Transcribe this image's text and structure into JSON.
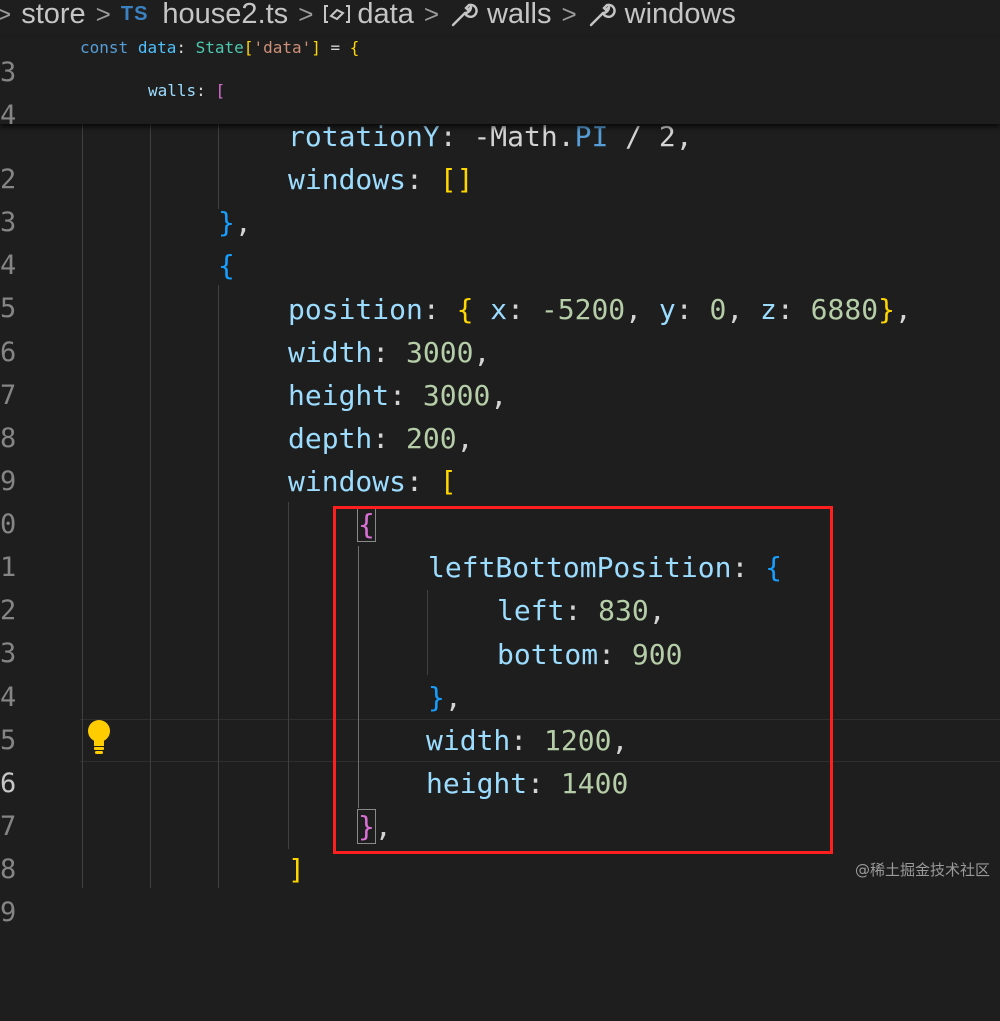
{
  "breadcrumb": {
    "items": [
      {
        "label": "store"
      },
      {
        "badge": "TS",
        "label": "house2.ts"
      },
      {
        "label": "data"
      },
      {
        "label": "walls"
      },
      {
        "label": "windows"
      }
    ]
  },
  "sticky_lines": [
    {
      "num": "3",
      "text": "const data: State['data'] = {"
    },
    {
      "num": "4",
      "text": "walls: ["
    }
  ],
  "lines": [
    {
      "num": "2",
      "text": "rotationY: -Math.PI / 2,"
    },
    {
      "num": "3",
      "text": "windows: []"
    },
    {
      "num": "4",
      "text": "},"
    },
    {
      "num": "5",
      "text": "{"
    },
    {
      "num": "6",
      "text": "position: { x: -5200, y: 0, z: 6880},"
    },
    {
      "num": "7",
      "text": "width: 3000,"
    },
    {
      "num": "8",
      "text": "height: 3000,"
    },
    {
      "num": "9",
      "text": "depth: 200,"
    },
    {
      "num": "0",
      "text": "windows: ["
    },
    {
      "num": "1",
      "text": "{"
    },
    {
      "num": "2",
      "text": "leftBottomPosition: {"
    },
    {
      "num": "3",
      "text": "left: 830,"
    },
    {
      "num": "4",
      "text": "bottom: 900"
    },
    {
      "num": "5",
      "text": "},"
    },
    {
      "num": "6",
      "text": "width: 1200,",
      "active": true
    },
    {
      "num": "7",
      "text": "height: 1400"
    },
    {
      "num": "8",
      "text": "},"
    },
    {
      "num": "9",
      "text": "]"
    }
  ],
  "tokens": {
    "const": "const",
    "data": "data",
    "colon": ":",
    "state": "State",
    "lbr": "[",
    "str": "'data'",
    "rbr": "]",
    "eq": "=",
    "lbrace": "{",
    "rbrace": "}",
    "walls": "walls",
    "rotationY": "rotationY",
    "minus_math": "-Math.",
    "pi": "PI",
    "div2": "/ 2",
    "comma": ",",
    "windows": "windows",
    "position": "position",
    "x": "x",
    "y": "y",
    "z": "z",
    "v_m5200": "-5200",
    "v_0": "0",
    "v_6880": "6880",
    "width": "width",
    "height": "height",
    "depth": "depth",
    "v_3000": "3000",
    "v_200": "200",
    "leftBottomPosition": "leftBottomPosition",
    "left": "left",
    "bottom": "bottom",
    "v_830": "830",
    "v_900": "900",
    "v_1200": "1200",
    "v_1400": "1400",
    "lbrk_gold": "[",
    "rbrk_gold": "]"
  },
  "watermark": "@稀土掘金技术社区",
  "colors": {
    "background": "#1e1e1e",
    "keyword": "#569cd6",
    "property": "#9cdcfe",
    "number": "#b5cea8",
    "string": "#ce9178",
    "type": "#4ec9b0",
    "bracket_gold": "#ffd700",
    "bracket_purple": "#da70d6",
    "bracket_blue": "#179fff",
    "highlight_box": "#ff1f1f"
  }
}
